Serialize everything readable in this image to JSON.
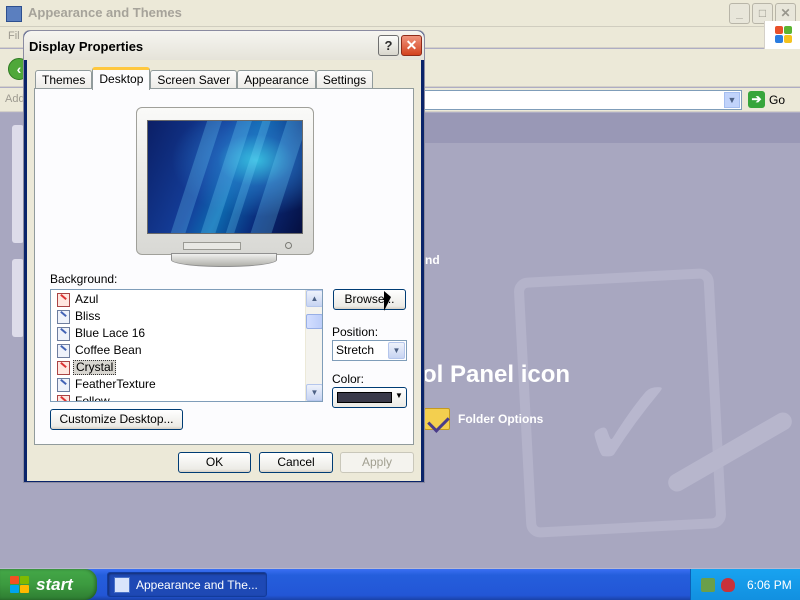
{
  "background_window": {
    "title": "Appearance and Themes",
    "menu_fragment": "Fil",
    "address_label": "Add",
    "go_label": "Go",
    "content_fragment": "nd",
    "pick_text_fragment": "ol Panel icon",
    "folder_options_label": "Folder Options"
  },
  "dialog": {
    "title": "Display Properties",
    "help_label": "?",
    "close_label": "✕",
    "tabs": [
      {
        "label": "Themes"
      },
      {
        "label": "Desktop"
      },
      {
        "label": "Screen Saver"
      },
      {
        "label": "Appearance"
      },
      {
        "label": "Settings"
      }
    ],
    "active_tab": "Desktop",
    "background_label": "Background:",
    "backgrounds": [
      {
        "label": "Azul"
      },
      {
        "label": "Bliss"
      },
      {
        "label": "Blue Lace 16"
      },
      {
        "label": "Coffee Bean"
      },
      {
        "label": "Crystal"
      },
      {
        "label": "FeatherTexture"
      },
      {
        "label": "Follow"
      }
    ],
    "selected_background": "Crystal",
    "browse_label": "Browse...",
    "position_label": "Position:",
    "position_value": "Stretch",
    "color_label": "Color:",
    "color_value": "#3a3a4a",
    "customize_label": "Customize Desktop...",
    "ok_label": "OK",
    "cancel_label": "Cancel",
    "apply_label": "Apply"
  },
  "taskbar": {
    "start_label": "start",
    "task_label": "Appearance and The...",
    "clock": "6:06 PM"
  },
  "colors": {
    "xp_blue": "#245edc",
    "start_green": "#3c9a3f",
    "tab_highlight": "#ffc83c"
  }
}
